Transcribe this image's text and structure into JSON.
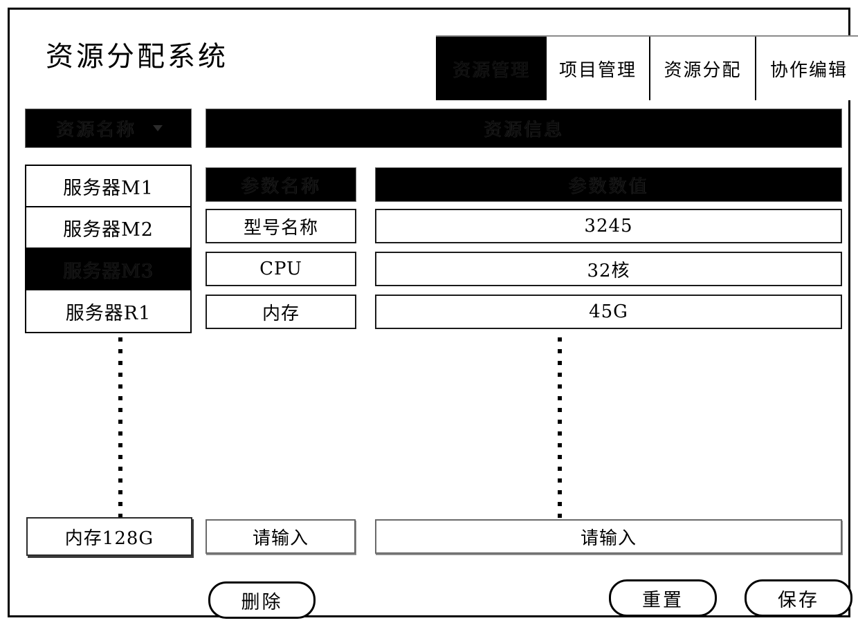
{
  "app": {
    "title": "资源分配系统"
  },
  "tabs": [
    {
      "label": "资源管理",
      "active": true
    },
    {
      "label": "项目管理",
      "active": false
    },
    {
      "label": "资源分配",
      "active": false
    },
    {
      "label": "协作编辑",
      "active": false
    }
  ],
  "sidebar": {
    "header_label": "资源名称",
    "header_icon": "chevron-down-icon",
    "items": [
      {
        "label": "服务器M1",
        "selected": false
      },
      {
        "label": "服务器M2",
        "selected": false
      },
      {
        "label": "服务器M3",
        "selected": true
      },
      {
        "label": "服务器R1",
        "selected": false
      }
    ],
    "ellipsis": "vertical-dots",
    "footer_input_value": "内存128G"
  },
  "panel": {
    "header_label": "资源信息",
    "columns": {
      "name": "参数名称",
      "value": "参数数值"
    },
    "rows": [
      {
        "name": "型号名称",
        "value": "3245"
      },
      {
        "name": "CPU",
        "value": "32核"
      },
      {
        "name": "内存",
        "value": "45G"
      }
    ],
    "ellipsis": "vertical-dots",
    "new_param_name_placeholder": "请输入",
    "new_param_value_placeholder": "请输入"
  },
  "actions": {
    "delete_label": "删除",
    "reset_label": "重置",
    "save_label": "保存"
  },
  "colors": {
    "ink": "#000000",
    "paper": "#ffffff",
    "muted_border": "#6a6a6a"
  }
}
